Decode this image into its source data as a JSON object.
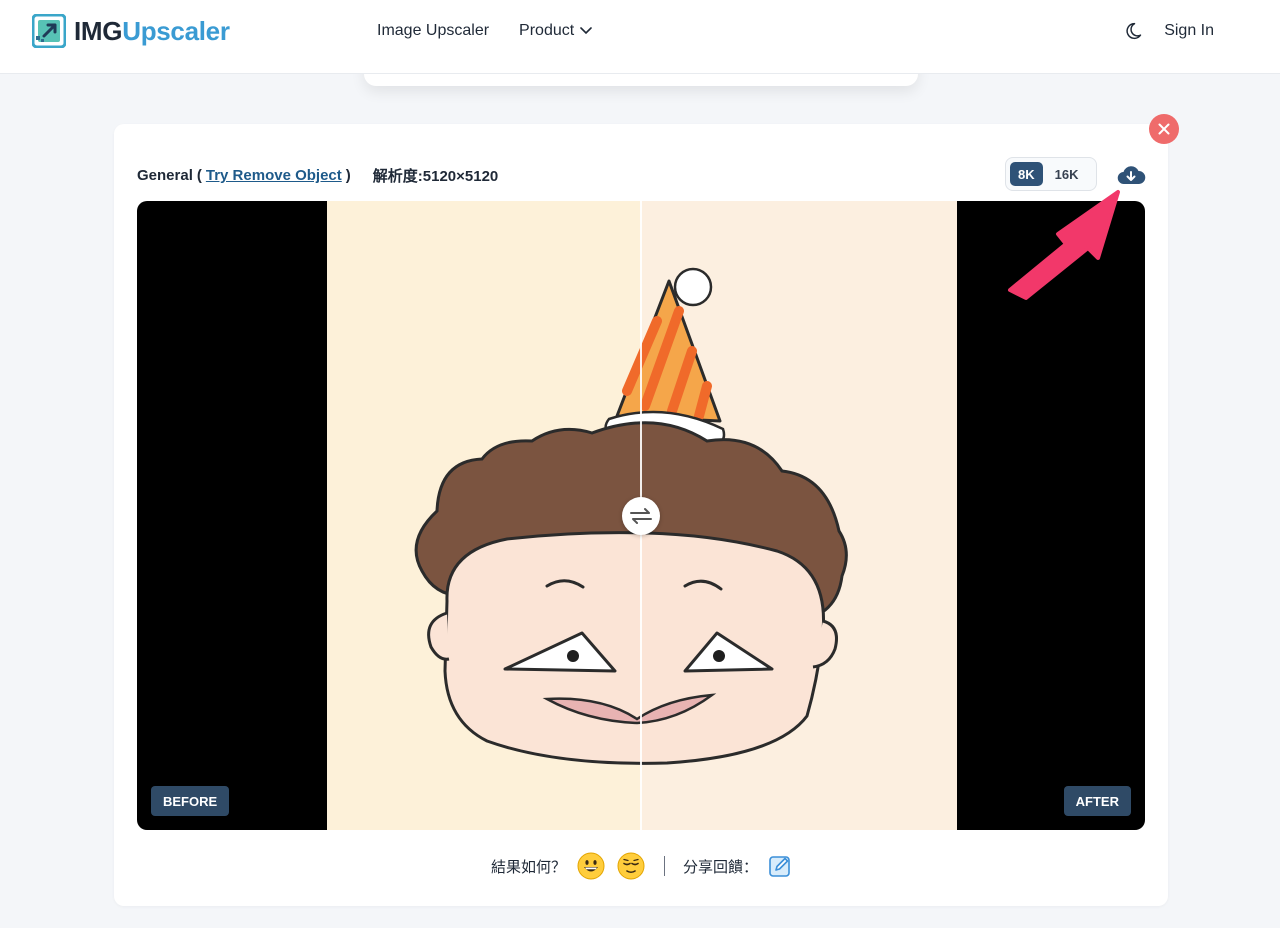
{
  "header": {
    "logo_part1": "IMG",
    "logo_part2": "Upscaler",
    "nav": [
      {
        "label": "Image Upscaler"
      },
      {
        "label": "Product"
      }
    ],
    "sign_in": "Sign In",
    "icons": {
      "theme": "moon-icon",
      "product_dropdown": "chevron-down-icon"
    }
  },
  "card": {
    "model": "General",
    "open_paren": "(",
    "close_paren": ")",
    "link": "Try Remove Object",
    "resolution": "解析度:5120×5120",
    "resolution_options": [
      "8K",
      "16K"
    ],
    "selected_resolution": "8K",
    "before_label": "BEFORE",
    "after_label": "AFTER",
    "icons": {
      "close": "close-icon",
      "download": "cloud-download-icon",
      "swap": "swap-arrows-icon"
    }
  },
  "feedback": {
    "question": "結果如何？",
    "share": "分享回饋：",
    "icons": [
      "grinning-face-icon",
      "relieved-face-icon",
      "edit-icon"
    ]
  },
  "colors": {
    "accent": "#3a9bd3",
    "dark_blue": "#2f5277",
    "close_red": "#ef6b6b",
    "annotation_pink": "#f2386a"
  }
}
